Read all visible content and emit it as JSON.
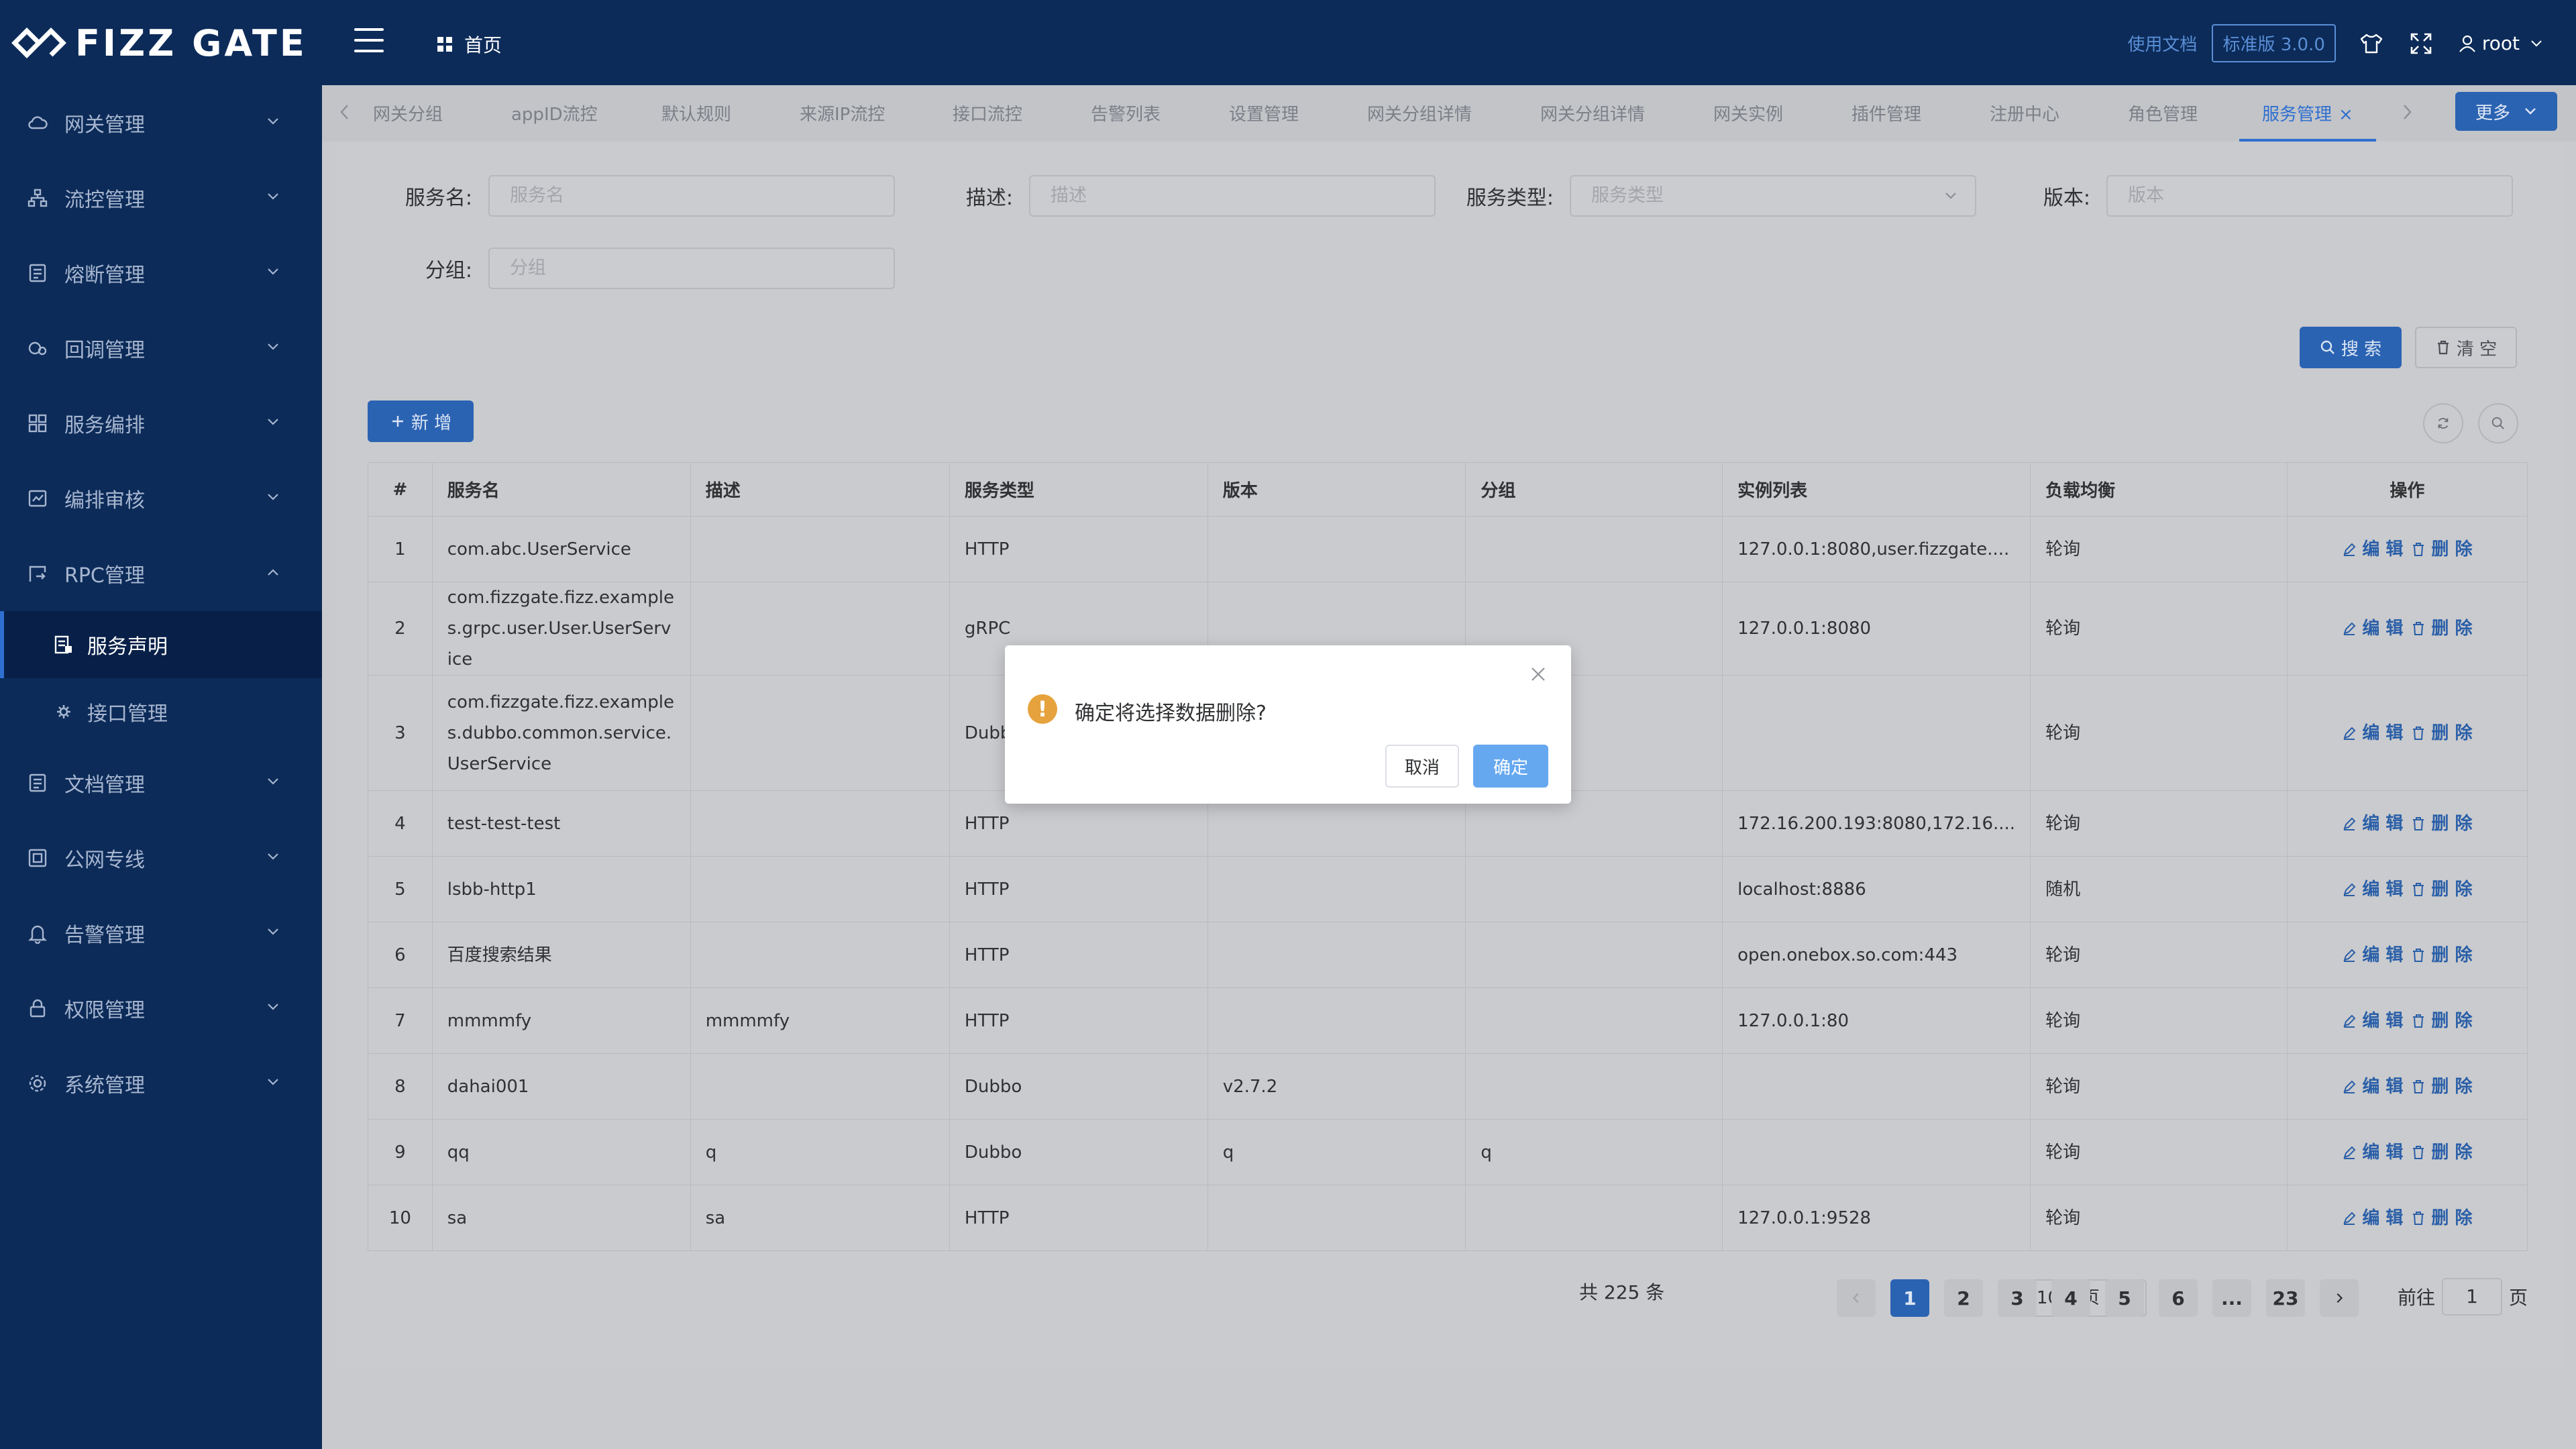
{
  "header": {
    "logo_text": "FIZZ GATE",
    "home_label": "首页",
    "docs_label": "使用文档",
    "version_label": "标准版 3.0.0",
    "user_name": "root"
  },
  "sidebar": {
    "items": [
      {
        "label": "网关管理",
        "icon": "cloud-icon"
      },
      {
        "label": "流控管理",
        "icon": "flow-icon"
      },
      {
        "label": "熔断管理",
        "icon": "fuse-icon"
      },
      {
        "label": "回调管理",
        "icon": "callback-icon"
      },
      {
        "label": "服务编排",
        "icon": "grid-icon"
      },
      {
        "label": "编排审核",
        "icon": "audit-icon"
      },
      {
        "label": "RPC管理",
        "icon": "rpc-icon",
        "expanded": true,
        "children": [
          {
            "label": "服务声明",
            "icon": "list-icon",
            "active": true
          },
          {
            "label": "接口管理",
            "icon": "gear-icon"
          }
        ]
      },
      {
        "label": "文档管理",
        "icon": "document-icon"
      },
      {
        "label": "公网专线",
        "icon": "network-icon"
      },
      {
        "label": "告警管理",
        "icon": "bell-icon"
      },
      {
        "label": "权限管理",
        "icon": "lock-icon"
      },
      {
        "label": "系统管理",
        "icon": "settings-icon"
      }
    ]
  },
  "tabs": {
    "items": [
      "网关分组",
      "appID流控",
      "默认规则",
      "来源IP流控",
      "接口流控",
      "告警列表",
      "设置管理",
      "网关分组详情",
      "网关分组详情",
      "网关实例",
      "插件管理",
      "注册中心",
      "角色管理",
      "服务管理"
    ],
    "active_index": 13,
    "more_label": "更多"
  },
  "filters": {
    "service_name": {
      "label": "服务名:",
      "placeholder": "服务名"
    },
    "description": {
      "label": "描述:",
      "placeholder": "描述"
    },
    "service_type": {
      "label": "服务类型:",
      "placeholder": "服务类型"
    },
    "version": {
      "label": "版本:",
      "placeholder": "版本"
    },
    "group": {
      "label": "分组:",
      "placeholder": "分组"
    },
    "search_label": "搜 索",
    "clear_label": "清 空"
  },
  "toolbar": {
    "add_label": "新 增"
  },
  "table": {
    "columns": [
      "#",
      "服务名",
      "描述",
      "服务类型",
      "版本",
      "分组",
      "实例列表",
      "负载均衡",
      "操作"
    ],
    "edit_label": "编 辑",
    "delete_label": "删 除",
    "rows": [
      {
        "idx": "1",
        "name": "com.abc.UserService",
        "desc": "",
        "type": "HTTP",
        "version": "",
        "group": "",
        "instances": "127.0.0.1:8080,user.fizzgate....",
        "lb": "轮询"
      },
      {
        "idx": "2",
        "name": "com.fizzgate.fizz.examples.grpc.user.User.UserService",
        "desc": "",
        "type": "gRPC",
        "version": "",
        "group": "",
        "instances": "127.0.0.1:8080",
        "lb": "轮询"
      },
      {
        "idx": "3",
        "name": "com.fizzgate.fizz.examples.dubbo.common.service.UserService",
        "desc": "",
        "type": "Dubbo",
        "version": "",
        "group": "",
        "instances": "",
        "lb": "轮询"
      },
      {
        "idx": "4",
        "name": "test-test-test",
        "desc": "",
        "type": "HTTP",
        "version": "",
        "group": "",
        "instances": "172.16.200.193:8080,172.16....",
        "lb": "轮询"
      },
      {
        "idx": "5",
        "name": "lsbb-http1",
        "desc": "",
        "type": "HTTP",
        "version": "",
        "group": "",
        "instances": "localhost:8886",
        "lb": "随机"
      },
      {
        "idx": "6",
        "name": "百度搜索结果",
        "desc": "",
        "type": "HTTP",
        "version": "",
        "group": "",
        "instances": "open.onebox.so.com:443",
        "lb": "轮询"
      },
      {
        "idx": "7",
        "name": "mmmmfy",
        "desc": "mmmmfy",
        "type": "HTTP",
        "version": "",
        "group": "",
        "instances": "127.0.0.1:80",
        "lb": "轮询"
      },
      {
        "idx": "8",
        "name": "dahai001",
        "desc": "",
        "type": "Dubbo",
        "version": "v2.7.2",
        "group": "",
        "instances": "",
        "lb": "轮询"
      },
      {
        "idx": "9",
        "name": "qq",
        "desc": "q",
        "type": "Dubbo",
        "version": "q",
        "group": "q",
        "instances": "",
        "lb": "轮询"
      },
      {
        "idx": "10",
        "name": "sa",
        "desc": "sa",
        "type": "HTTP",
        "version": "",
        "group": "",
        "instances": "127.0.0.1:9528",
        "lb": "轮询"
      }
    ]
  },
  "pagination": {
    "total_label": "共 225 条",
    "page_size": "10条/页",
    "pages": [
      "1",
      "2",
      "3",
      "4",
      "5",
      "6",
      "...",
      "23"
    ],
    "current": "1",
    "goto_prefix": "前往",
    "goto_value": "1",
    "goto_suffix": "页"
  },
  "dialog": {
    "message": "确定将选择数据删除?",
    "cancel_label": "取消",
    "confirm_label": "确定"
  }
}
